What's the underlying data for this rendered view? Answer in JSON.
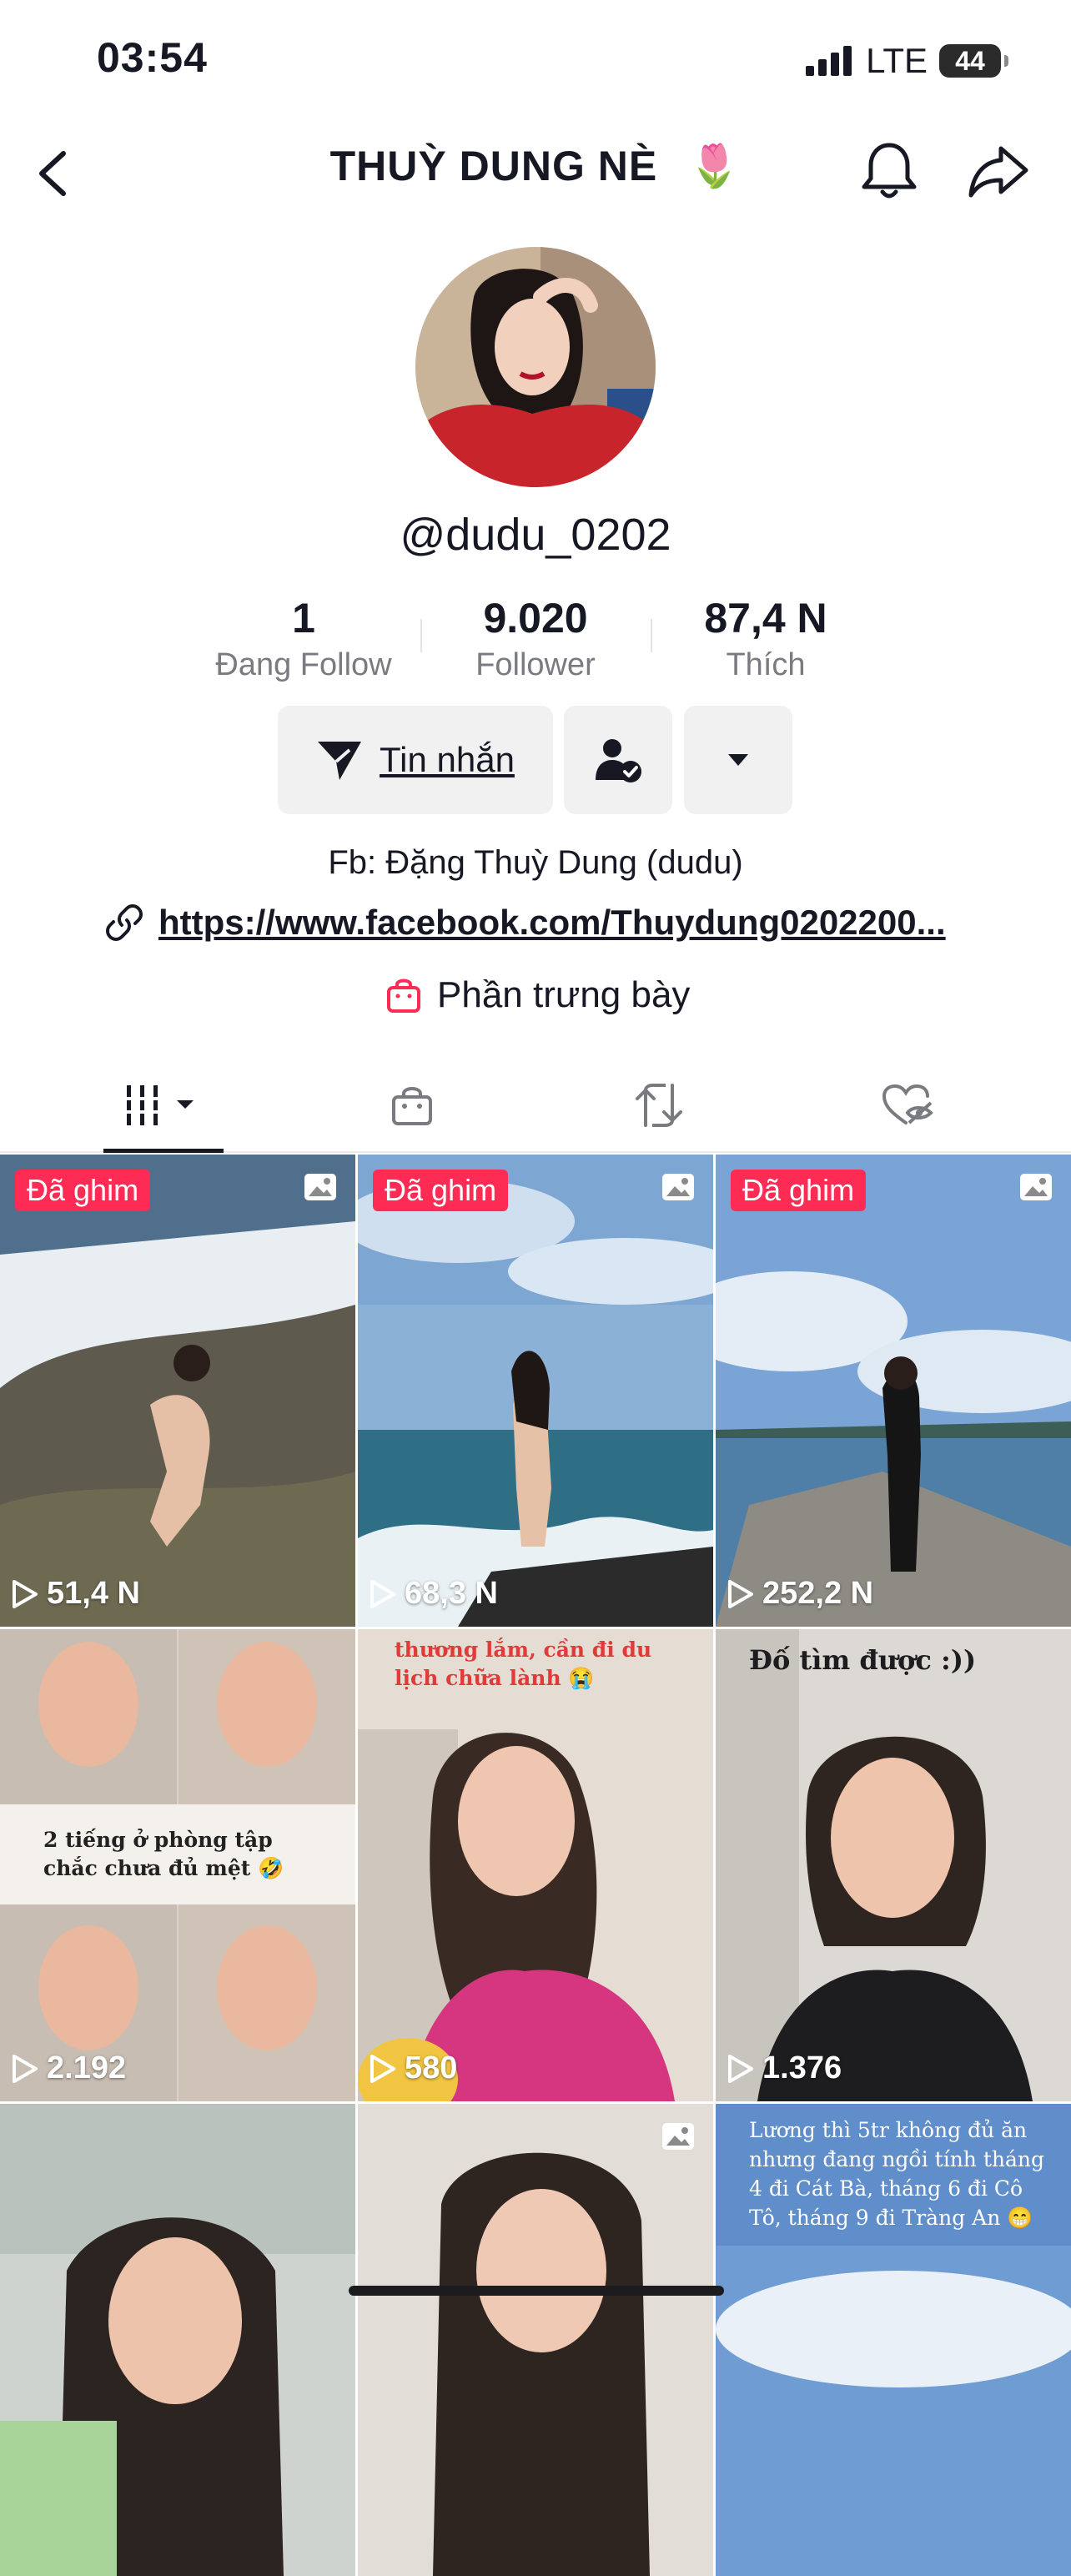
{
  "status_bar": {
    "time": "03:54",
    "network": "LTE",
    "battery": "44"
  },
  "header": {
    "title": "THUỲ DUNG NÈ",
    "title_emoji": "🌷"
  },
  "profile": {
    "username": "@dudu_0202",
    "stats": [
      {
        "value": "1",
        "label": "Đang Follow"
      },
      {
        "value": "9.020",
        "label": "Follower"
      },
      {
        "value": "87,4 N",
        "label": "Thích"
      }
    ],
    "message_button": "Tin nhắn",
    "bio": "Fb: Đặng Thuỳ Dung (dudu)",
    "link": "https://www.facebook.com/Thuydung0202200...",
    "showcase": "Phần trưng bày"
  },
  "tabs": [
    "videos-icon",
    "shop-icon",
    "repost-icon",
    "liked-hidden-icon"
  ],
  "colors": {
    "accent": "#fe2c55",
    "text": "#161823",
    "muted": "#7a7b81"
  },
  "grid": [
    {
      "pinned": "Đã ghim",
      "photo": true,
      "views": "51,4 N",
      "caption": ""
    },
    {
      "pinned": "Đã ghim",
      "photo": true,
      "views": "68,3 N",
      "caption": ""
    },
    {
      "pinned": "Đã ghim",
      "photo": true,
      "views": "252,2 N",
      "caption": ""
    },
    {
      "pinned": "",
      "photo": false,
      "views": "2.192",
      "caption": "2 tiếng ở phòng tập chắc chưa đủ mệt 🤣"
    },
    {
      "pinned": "",
      "photo": false,
      "views": "580",
      "caption": "thương lắm, cần đi du lịch chữa lành 😭"
    },
    {
      "pinned": "",
      "photo": false,
      "views": "1.376",
      "caption": "Đố tìm được :))"
    },
    {
      "pinned": "",
      "photo": false,
      "views": "",
      "caption": ""
    },
    {
      "pinned": "",
      "photo": true,
      "views": "",
      "caption": ""
    },
    {
      "pinned": "",
      "photo": false,
      "views": "",
      "caption": "Lương thì 5tr không đủ ăn nhưng đang ngồi tính tháng 4 đi Cát Bà, tháng 6 đi Cô Tô, tháng 9 đi Tràng An 😁"
    }
  ]
}
